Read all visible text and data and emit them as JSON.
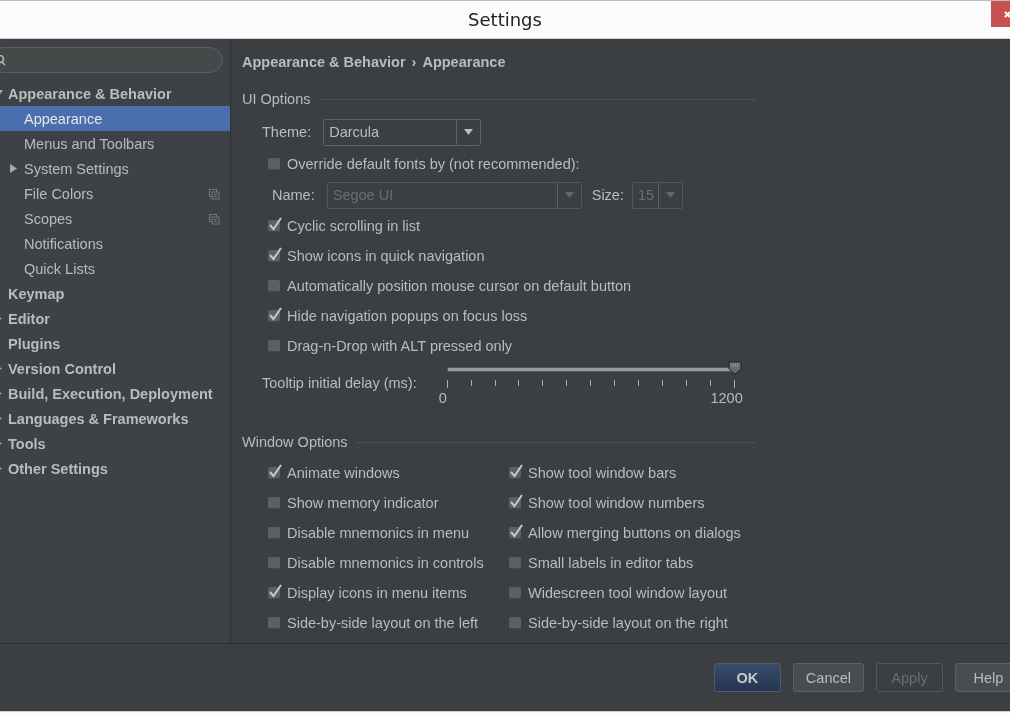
{
  "window": {
    "title": "Settings"
  },
  "sidebar": {
    "tree": [
      {
        "label": "Appearance & Behavior",
        "expanded": true,
        "selected": false,
        "children": [
          {
            "label": "Appearance",
            "selected": true
          },
          {
            "label": "Menus and Toolbars",
            "selected": false
          },
          {
            "label": "System Settings",
            "expanded": false,
            "selected": false
          },
          {
            "label": "File Colors",
            "selected": false,
            "project_level": true
          },
          {
            "label": "Scopes",
            "selected": false,
            "project_level": true
          },
          {
            "label": "Notifications",
            "selected": false
          },
          {
            "label": "Quick Lists",
            "selected": false
          }
        ]
      },
      {
        "label": "Keymap",
        "selected": false
      },
      {
        "label": "Editor",
        "expanded": false,
        "selected": false
      },
      {
        "label": "Plugins",
        "selected": false
      },
      {
        "label": "Version Control",
        "expanded": false,
        "selected": false
      },
      {
        "label": "Build, Execution, Deployment",
        "expanded": false,
        "selected": false
      },
      {
        "label": "Languages & Frameworks",
        "expanded": false,
        "selected": false
      },
      {
        "label": "Tools",
        "expanded": false,
        "selected": false
      },
      {
        "label": "Other Settings",
        "expanded": false,
        "selected": false
      }
    ]
  },
  "breadcrumb": {
    "parts": [
      "Appearance & Behavior",
      "Appearance"
    ],
    "separator": "›"
  },
  "ui_options": {
    "title": "UI Options",
    "items": [
      {
        "kind": "combo",
        "label": "Theme:",
        "value": "Darcula",
        "disabled": false
      },
      {
        "kind": "checkbox",
        "label": "Override default fonts by (not recommended):",
        "checked": false
      },
      {
        "kind": "font",
        "disabled": true,
        "name_label": "Name:",
        "name_value": "Segoe UI",
        "size_label": "Size:",
        "size_value": "15"
      },
      {
        "kind": "checkbox",
        "label": "Cyclic scrolling in list",
        "checked": true
      },
      {
        "kind": "checkbox",
        "label": "Show icons in quick navigation",
        "checked": true
      },
      {
        "kind": "checkbox",
        "label": "Automatically position mouse cursor on default button",
        "checked": false
      },
      {
        "kind": "checkbox",
        "label": "Hide navigation popups on focus loss",
        "checked": true
      },
      {
        "kind": "checkbox",
        "label": "Drag-n-Drop with ALT pressed only",
        "checked": false
      },
      {
        "kind": "slider",
        "label": "Tooltip initial delay (ms):",
        "level": 1,
        "min_label": "0",
        "max_label": "1200"
      }
    ]
  },
  "window_options": {
    "title": "Window Options",
    "items": [
      {
        "label": "Animate windows",
        "checked": true
      },
      {
        "label": "Show tool window bars",
        "checked": true
      },
      {
        "label": "Show memory indicator",
        "checked": false
      },
      {
        "label": "Show tool window numbers",
        "checked": true
      },
      {
        "label": "Disable mnemonics in menu",
        "checked": false
      },
      {
        "label": "Allow merging buttons on dialogs",
        "checked": true
      },
      {
        "label": "Disable mnemonics in controls",
        "checked": false
      },
      {
        "label": "Small labels in editor tabs",
        "checked": false
      },
      {
        "label": "Display icons in menu items",
        "checked": true
      },
      {
        "label": "Widescreen tool window layout",
        "checked": false
      },
      {
        "label": "Side-by-side layout on the left",
        "checked": false
      },
      {
        "label": "Side-by-side layout on the right",
        "checked": false
      }
    ]
  },
  "buttons": [
    {
      "label": "OK",
      "kind": "default",
      "disabled": false
    },
    {
      "label": "Cancel",
      "kind": "normal",
      "disabled": false
    },
    {
      "label": "Apply",
      "kind": "normal",
      "disabled": true
    },
    {
      "label": "Help",
      "kind": "normal",
      "disabled": false
    }
  ]
}
